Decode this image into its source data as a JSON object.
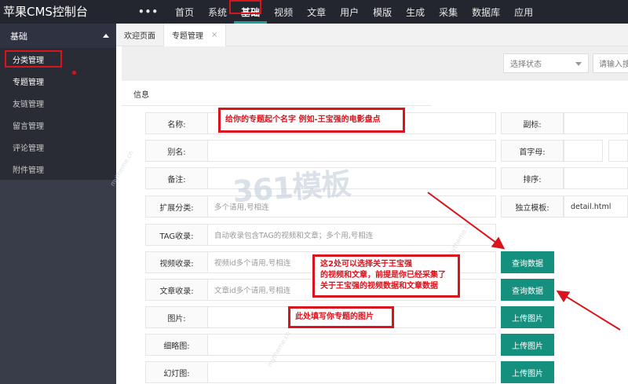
{
  "app": {
    "title": "苹果CMS控制台"
  },
  "topnav": {
    "more": "•••",
    "items": [
      "首页",
      "系统",
      "基础",
      "视频",
      "文章",
      "用户",
      "模版",
      "生成",
      "采集",
      "数据库",
      "应用"
    ]
  },
  "sidebar": {
    "header": "基础",
    "items": [
      "分类管理",
      "专题管理",
      "友链管理",
      "留言管理",
      "评论管理",
      "附件管理"
    ]
  },
  "tabs": {
    "welcome": "欢迎页面",
    "topic": "专题管理",
    "close": "×"
  },
  "filter": {
    "status_placeholder": "选择状态",
    "search_placeholder": "请输入搜"
  },
  "form": {
    "section": "信息",
    "name_label": "名称:",
    "subtitle_label": "副标:",
    "alias_label": "别名:",
    "initial_label": "首字母:",
    "remark_label": "备注:",
    "sort_label": "排序:",
    "ext_label": "扩展分类:",
    "ext_placeholder": "多个请用,号相连",
    "tpl_label": "独立模板:",
    "tpl_value": "detail.html",
    "tag_label": "TAG收录:",
    "tag_placeholder": "自动收录包含TAG的视频和文章；多个用,号相连",
    "video_label": "视频收录:",
    "video_placeholder": "视频id多个请用,号相连",
    "article_label": "文章收录:",
    "article_placeholder": "文章id多个请用,号相连",
    "pic_label": "图片:",
    "thumb_label": "细略图:",
    "slide_label": "幻灯图:",
    "query_btn": "查询数据",
    "upload_btn": "上传图片"
  },
  "annotations": {
    "name_tip": "给你的专题起个名字 例如-王宝强的电影盘点",
    "collect_tip_1": "这2处可以选择关于王宝强",
    "collect_tip_2": "的视频和文章，前提是你已经采集了",
    "collect_tip_3": "关于王宝强的视频数据和文章数据",
    "pic_tip": "此处填写你专题的图片"
  },
  "watermark": {
    "logo": "361模板",
    "site": "mytheme.cn"
  },
  "colors": {
    "accent": "#15907f",
    "annotation": "#d8141c",
    "topbar": "#24262f",
    "sidebar": "#393d49"
  }
}
